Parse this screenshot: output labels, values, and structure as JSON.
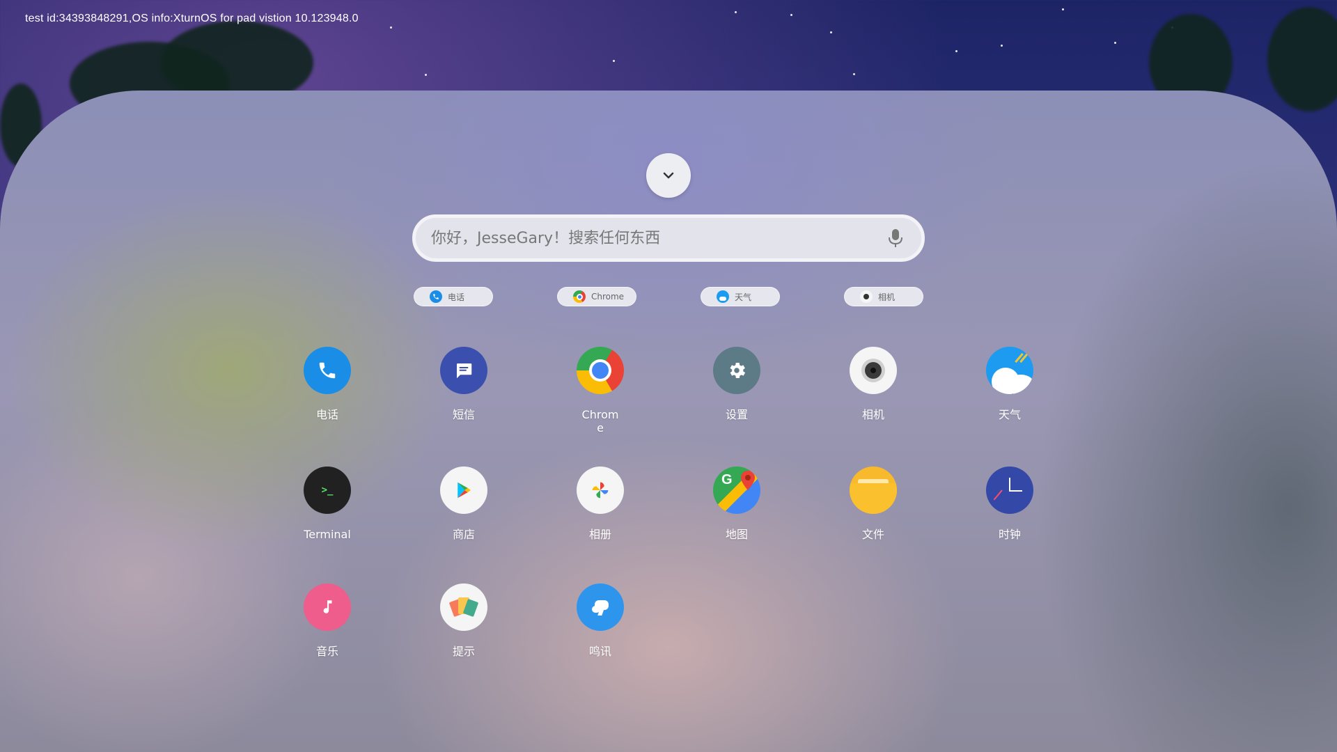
{
  "status_bar": {
    "text": "test id:34393848291,OS info:XturnOS for pad vistion 10.123948.0"
  },
  "search": {
    "placeholder": "你好，JesseGary！搜索任何东西"
  },
  "colors": {
    "phone_blue": "#1a8ee6",
    "messages_indigo": "#3a4fae",
    "settings_gray": "#5d7b86",
    "terminal_black": "#212121",
    "files_yellow": "#f9b92c",
    "clock_indigo": "#3448a8",
    "music_pink": "#ee5d8c",
    "chat_blue": "#2e95ec"
  },
  "suggestions": [
    {
      "label": "电话",
      "icon": "phone-icon"
    },
    {
      "label": "Chrome",
      "icon": "chrome-icon"
    },
    {
      "label": "天气",
      "icon": "weather-icon"
    },
    {
      "label": "相机",
      "icon": "camera-icon"
    }
  ],
  "apps": [
    {
      "label": "电话",
      "icon": "phone-icon"
    },
    {
      "label": "短信",
      "icon": "messages-icon"
    },
    {
      "label": "Chrome",
      "icon": "chrome-icon"
    },
    {
      "label": "设置",
      "icon": "settings-icon"
    },
    {
      "label": "相机",
      "icon": "camera-icon"
    },
    {
      "label": "天气",
      "icon": "weather-icon"
    },
    {
      "label": "Terminal",
      "icon": "terminal-icon"
    },
    {
      "label": "商店",
      "icon": "play-store-icon"
    },
    {
      "label": "相册",
      "icon": "photos-icon"
    },
    {
      "label": "地图",
      "icon": "maps-icon"
    },
    {
      "label": "文件",
      "icon": "files-icon"
    },
    {
      "label": "时钟",
      "icon": "clock-icon"
    },
    {
      "label": "音乐",
      "icon": "music-icon"
    },
    {
      "label": "提示",
      "icon": "tips-icon"
    },
    {
      "label": "鸣讯",
      "icon": "chat-icon"
    }
  ]
}
